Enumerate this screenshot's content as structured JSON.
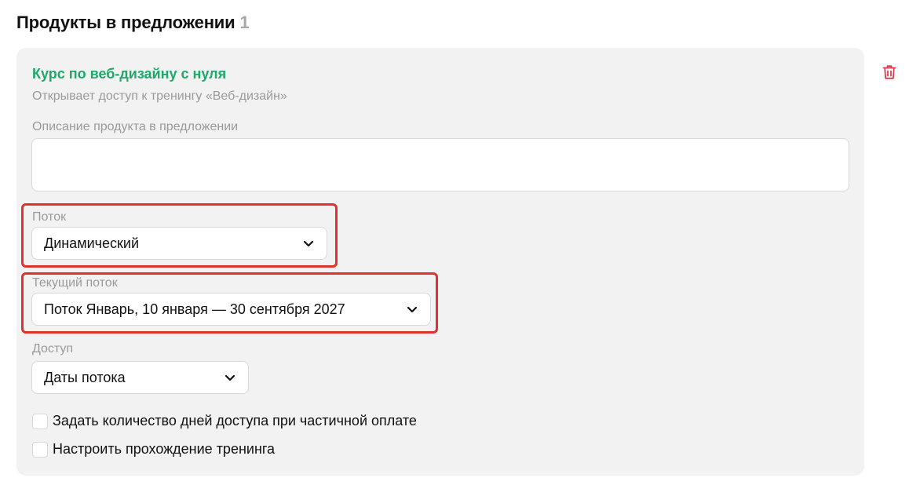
{
  "section": {
    "title": "Продукты в предложении",
    "count": "1"
  },
  "product": {
    "title": "Курс по веб-дизайну с нуля",
    "subtitle": "Открывает доступ к тренингу «Веб-дизайн»",
    "delete_icon": "trash-icon"
  },
  "description": {
    "label": "Описание продукта в предложении",
    "value": "",
    "placeholder": ""
  },
  "stream": {
    "label": "Поток",
    "value": "Динамический"
  },
  "current_stream": {
    "label": "Текущий поток",
    "value": "Поток Январь, 10 января — 30 сентября 2027"
  },
  "access": {
    "label": "Доступ",
    "value": "Даты потока"
  },
  "checkboxes": [
    {
      "label": "Задать количество дней доступа при частичной оплате",
      "checked": false
    },
    {
      "label": "Настроить прохождение тренинга",
      "checked": false
    }
  ],
  "colors": {
    "accent_green": "#1fa86a",
    "highlight_red": "#e0322d",
    "delete_red": "#e03a4f",
    "card_bg": "#f2f2f2"
  }
}
